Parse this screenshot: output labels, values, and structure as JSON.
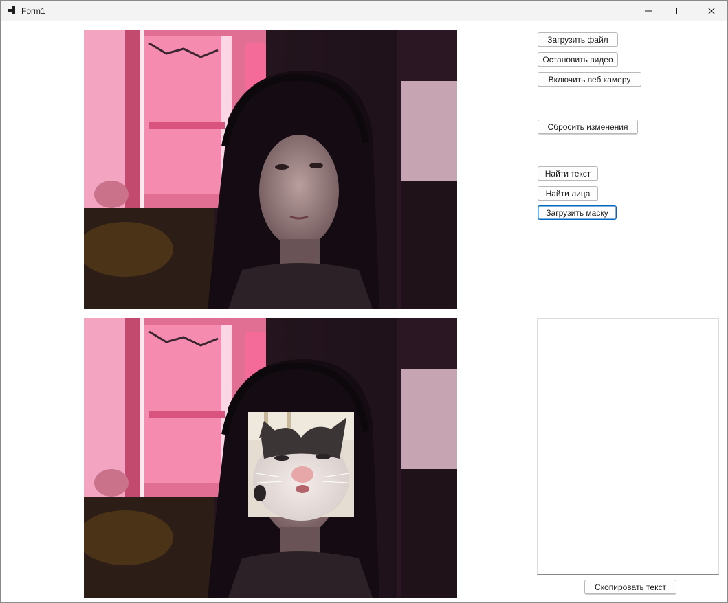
{
  "window": {
    "title": "Form1"
  },
  "controls": {
    "minimize_icon": "minimize-icon",
    "maximize_icon": "maximize-icon",
    "close_icon": "close-icon"
  },
  "buttons": {
    "load_file": "Загрузить файл",
    "stop_video": "Остановить видео",
    "enable_webcam": "Включить веб камеру",
    "reset_changes": "Сбросить изменения",
    "find_text": "Найти текст",
    "find_faces": "Найти лица",
    "load_mask": "Загрузить маску",
    "copy_text": "Скопировать текст"
  },
  "pictures": {
    "source_frame": "webcam-frame",
    "processed_frame": "webcam-frame-with-cat-mask"
  },
  "text_output": {
    "value": ""
  },
  "colors": {
    "focus_border": "#0067c0",
    "titlebar": "#f3f3f3"
  }
}
